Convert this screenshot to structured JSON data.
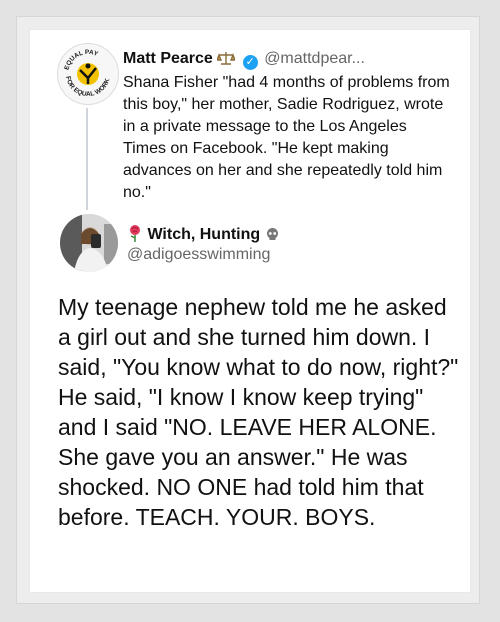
{
  "parent_tweet": {
    "author_name": "Matt Pearce",
    "author_handle": "@mattdpear...",
    "badge_text": "EQUAL PAY FOR EQUAL WORK",
    "text": "Shana Fisher \"had 4 months of problems from this boy,\" her mother, Sadie Rodriguez, wrote in a private message to the Los Angeles Times on Facebook. \"He kept making advances on her and she repeatedly told him no.\""
  },
  "quoted_tweet": {
    "author_name": "Witch, Hunting",
    "author_handle": "@adigoesswimming",
    "text": "My teenage nephew told me he asked a girl out and she turned him down. I said, \"You know what to do now, right?\" He said, \"I know I know keep trying\" and I said \"NO. LEAVE HER ALONE. She gave you an answer.\" He was shocked. NO ONE had told him that before. TEACH. YOUR. BOYS."
  },
  "colors": {
    "verified": "#1da1f2",
    "handle": "#666666",
    "badge_yellow": "#f2c200"
  }
}
